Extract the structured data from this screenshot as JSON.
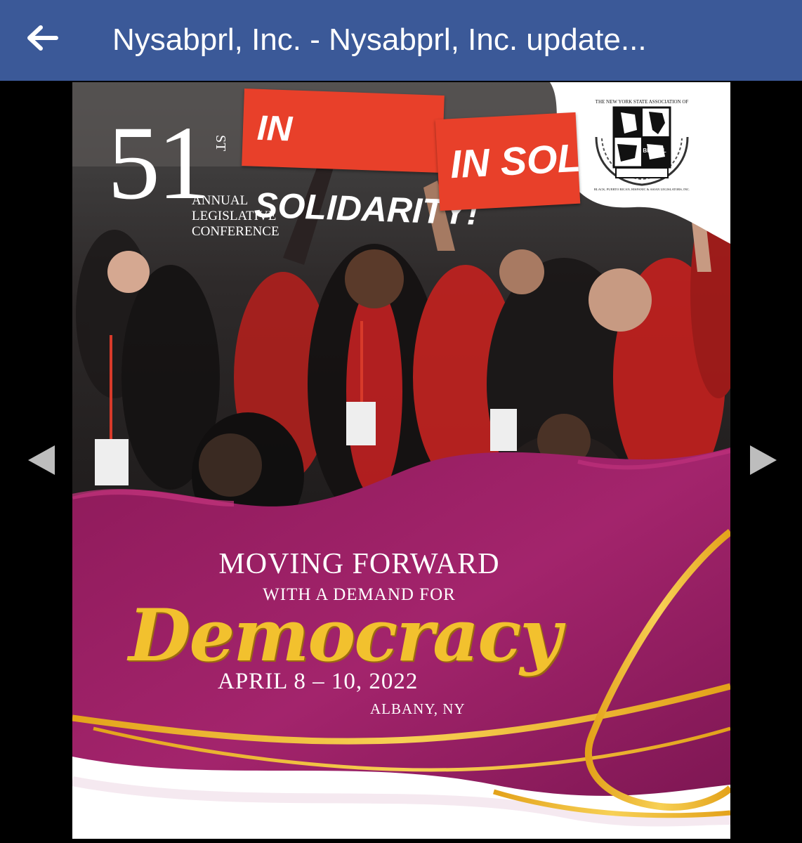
{
  "header": {
    "title": "Nysabprl, Inc. - Nysabprl, Inc. update...",
    "back_icon": "back-arrow-icon",
    "background_color": "#3b5998"
  },
  "viewer": {
    "prev_icon": "chevron-left-icon",
    "next_icon": "chevron-right-icon"
  },
  "poster": {
    "ordinal_number": "51",
    "ordinal_suffix": "ST",
    "conference_lines": [
      "ANNUAL",
      "LEGISLATIVE",
      "CONFERENCE"
    ],
    "signs": [
      "IN SOLIDARITY!",
      "IN SOLI"
    ],
    "logo": {
      "top_text": "THE NEW YORK STATE ASSOCIATION OF",
      "banner_text": "BPRHAL",
      "bottom_text": "BLACK, PUERTO RICAN, HISPANIC & ASIAN LEGISLATORS, INC."
    },
    "headline": "MOVING FORWARD",
    "subheadline": "WITH A DEMAND FOR",
    "script_word": "Democracy",
    "dates": "APRIL 8 – 10, 2022",
    "location": "ALBANY, NY",
    "colors": {
      "magenta": "#9c1f63",
      "gold": "#f2c12e",
      "red": "#e8402a"
    }
  }
}
